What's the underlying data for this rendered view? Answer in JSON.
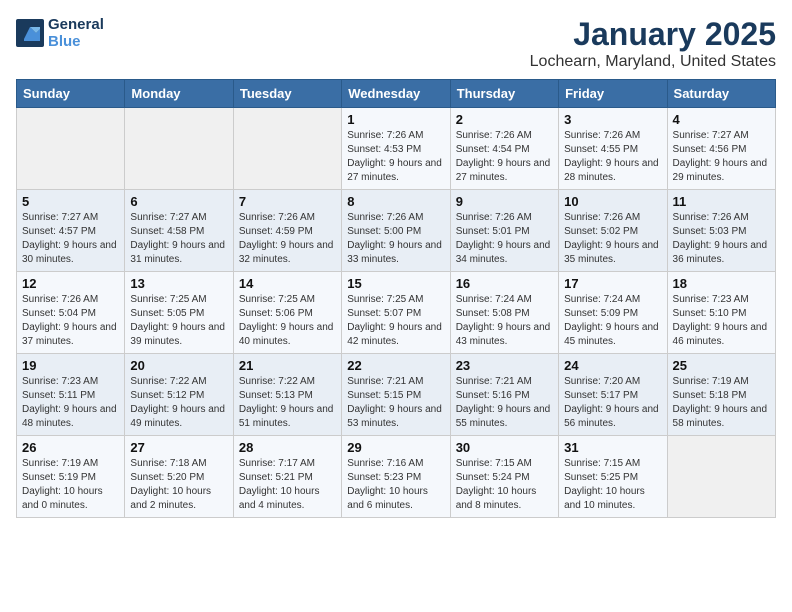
{
  "app": {
    "logo_line1": "General",
    "logo_line2": "Blue"
  },
  "title": "January 2025",
  "subtitle": "Lochearn, Maryland, United States",
  "days_of_week": [
    "Sunday",
    "Monday",
    "Tuesday",
    "Wednesday",
    "Thursday",
    "Friday",
    "Saturday"
  ],
  "weeks": [
    [
      {
        "day": "",
        "sunrise": "",
        "sunset": "",
        "daylight": ""
      },
      {
        "day": "",
        "sunrise": "",
        "sunset": "",
        "daylight": ""
      },
      {
        "day": "",
        "sunrise": "",
        "sunset": "",
        "daylight": ""
      },
      {
        "day": "1",
        "sunrise": "Sunrise: 7:26 AM",
        "sunset": "Sunset: 4:53 PM",
        "daylight": "Daylight: 9 hours and 27 minutes."
      },
      {
        "day": "2",
        "sunrise": "Sunrise: 7:26 AM",
        "sunset": "Sunset: 4:54 PM",
        "daylight": "Daylight: 9 hours and 27 minutes."
      },
      {
        "day": "3",
        "sunrise": "Sunrise: 7:26 AM",
        "sunset": "Sunset: 4:55 PM",
        "daylight": "Daylight: 9 hours and 28 minutes."
      },
      {
        "day": "4",
        "sunrise": "Sunrise: 7:27 AM",
        "sunset": "Sunset: 4:56 PM",
        "daylight": "Daylight: 9 hours and 29 minutes."
      }
    ],
    [
      {
        "day": "5",
        "sunrise": "Sunrise: 7:27 AM",
        "sunset": "Sunset: 4:57 PM",
        "daylight": "Daylight: 9 hours and 30 minutes."
      },
      {
        "day": "6",
        "sunrise": "Sunrise: 7:27 AM",
        "sunset": "Sunset: 4:58 PM",
        "daylight": "Daylight: 9 hours and 31 minutes."
      },
      {
        "day": "7",
        "sunrise": "Sunrise: 7:26 AM",
        "sunset": "Sunset: 4:59 PM",
        "daylight": "Daylight: 9 hours and 32 minutes."
      },
      {
        "day": "8",
        "sunrise": "Sunrise: 7:26 AM",
        "sunset": "Sunset: 5:00 PM",
        "daylight": "Daylight: 9 hours and 33 minutes."
      },
      {
        "day": "9",
        "sunrise": "Sunrise: 7:26 AM",
        "sunset": "Sunset: 5:01 PM",
        "daylight": "Daylight: 9 hours and 34 minutes."
      },
      {
        "day": "10",
        "sunrise": "Sunrise: 7:26 AM",
        "sunset": "Sunset: 5:02 PM",
        "daylight": "Daylight: 9 hours and 35 minutes."
      },
      {
        "day": "11",
        "sunrise": "Sunrise: 7:26 AM",
        "sunset": "Sunset: 5:03 PM",
        "daylight": "Daylight: 9 hours and 36 minutes."
      }
    ],
    [
      {
        "day": "12",
        "sunrise": "Sunrise: 7:26 AM",
        "sunset": "Sunset: 5:04 PM",
        "daylight": "Daylight: 9 hours and 37 minutes."
      },
      {
        "day": "13",
        "sunrise": "Sunrise: 7:25 AM",
        "sunset": "Sunset: 5:05 PM",
        "daylight": "Daylight: 9 hours and 39 minutes."
      },
      {
        "day": "14",
        "sunrise": "Sunrise: 7:25 AM",
        "sunset": "Sunset: 5:06 PM",
        "daylight": "Daylight: 9 hours and 40 minutes."
      },
      {
        "day": "15",
        "sunrise": "Sunrise: 7:25 AM",
        "sunset": "Sunset: 5:07 PM",
        "daylight": "Daylight: 9 hours and 42 minutes."
      },
      {
        "day": "16",
        "sunrise": "Sunrise: 7:24 AM",
        "sunset": "Sunset: 5:08 PM",
        "daylight": "Daylight: 9 hours and 43 minutes."
      },
      {
        "day": "17",
        "sunrise": "Sunrise: 7:24 AM",
        "sunset": "Sunset: 5:09 PM",
        "daylight": "Daylight: 9 hours and 45 minutes."
      },
      {
        "day": "18",
        "sunrise": "Sunrise: 7:23 AM",
        "sunset": "Sunset: 5:10 PM",
        "daylight": "Daylight: 9 hours and 46 minutes."
      }
    ],
    [
      {
        "day": "19",
        "sunrise": "Sunrise: 7:23 AM",
        "sunset": "Sunset: 5:11 PM",
        "daylight": "Daylight: 9 hours and 48 minutes."
      },
      {
        "day": "20",
        "sunrise": "Sunrise: 7:22 AM",
        "sunset": "Sunset: 5:12 PM",
        "daylight": "Daylight: 9 hours and 49 minutes."
      },
      {
        "day": "21",
        "sunrise": "Sunrise: 7:22 AM",
        "sunset": "Sunset: 5:13 PM",
        "daylight": "Daylight: 9 hours and 51 minutes."
      },
      {
        "day": "22",
        "sunrise": "Sunrise: 7:21 AM",
        "sunset": "Sunset: 5:15 PM",
        "daylight": "Daylight: 9 hours and 53 minutes."
      },
      {
        "day": "23",
        "sunrise": "Sunrise: 7:21 AM",
        "sunset": "Sunset: 5:16 PM",
        "daylight": "Daylight: 9 hours and 55 minutes."
      },
      {
        "day": "24",
        "sunrise": "Sunrise: 7:20 AM",
        "sunset": "Sunset: 5:17 PM",
        "daylight": "Daylight: 9 hours and 56 minutes."
      },
      {
        "day": "25",
        "sunrise": "Sunrise: 7:19 AM",
        "sunset": "Sunset: 5:18 PM",
        "daylight": "Daylight: 9 hours and 58 minutes."
      }
    ],
    [
      {
        "day": "26",
        "sunrise": "Sunrise: 7:19 AM",
        "sunset": "Sunset: 5:19 PM",
        "daylight": "Daylight: 10 hours and 0 minutes."
      },
      {
        "day": "27",
        "sunrise": "Sunrise: 7:18 AM",
        "sunset": "Sunset: 5:20 PM",
        "daylight": "Daylight: 10 hours and 2 minutes."
      },
      {
        "day": "28",
        "sunrise": "Sunrise: 7:17 AM",
        "sunset": "Sunset: 5:21 PM",
        "daylight": "Daylight: 10 hours and 4 minutes."
      },
      {
        "day": "29",
        "sunrise": "Sunrise: 7:16 AM",
        "sunset": "Sunset: 5:23 PM",
        "daylight": "Daylight: 10 hours and 6 minutes."
      },
      {
        "day": "30",
        "sunrise": "Sunrise: 7:15 AM",
        "sunset": "Sunset: 5:24 PM",
        "daylight": "Daylight: 10 hours and 8 minutes."
      },
      {
        "day": "31",
        "sunrise": "Sunrise: 7:15 AM",
        "sunset": "Sunset: 5:25 PM",
        "daylight": "Daylight: 10 hours and 10 minutes."
      },
      {
        "day": "",
        "sunrise": "",
        "sunset": "",
        "daylight": ""
      }
    ]
  ]
}
